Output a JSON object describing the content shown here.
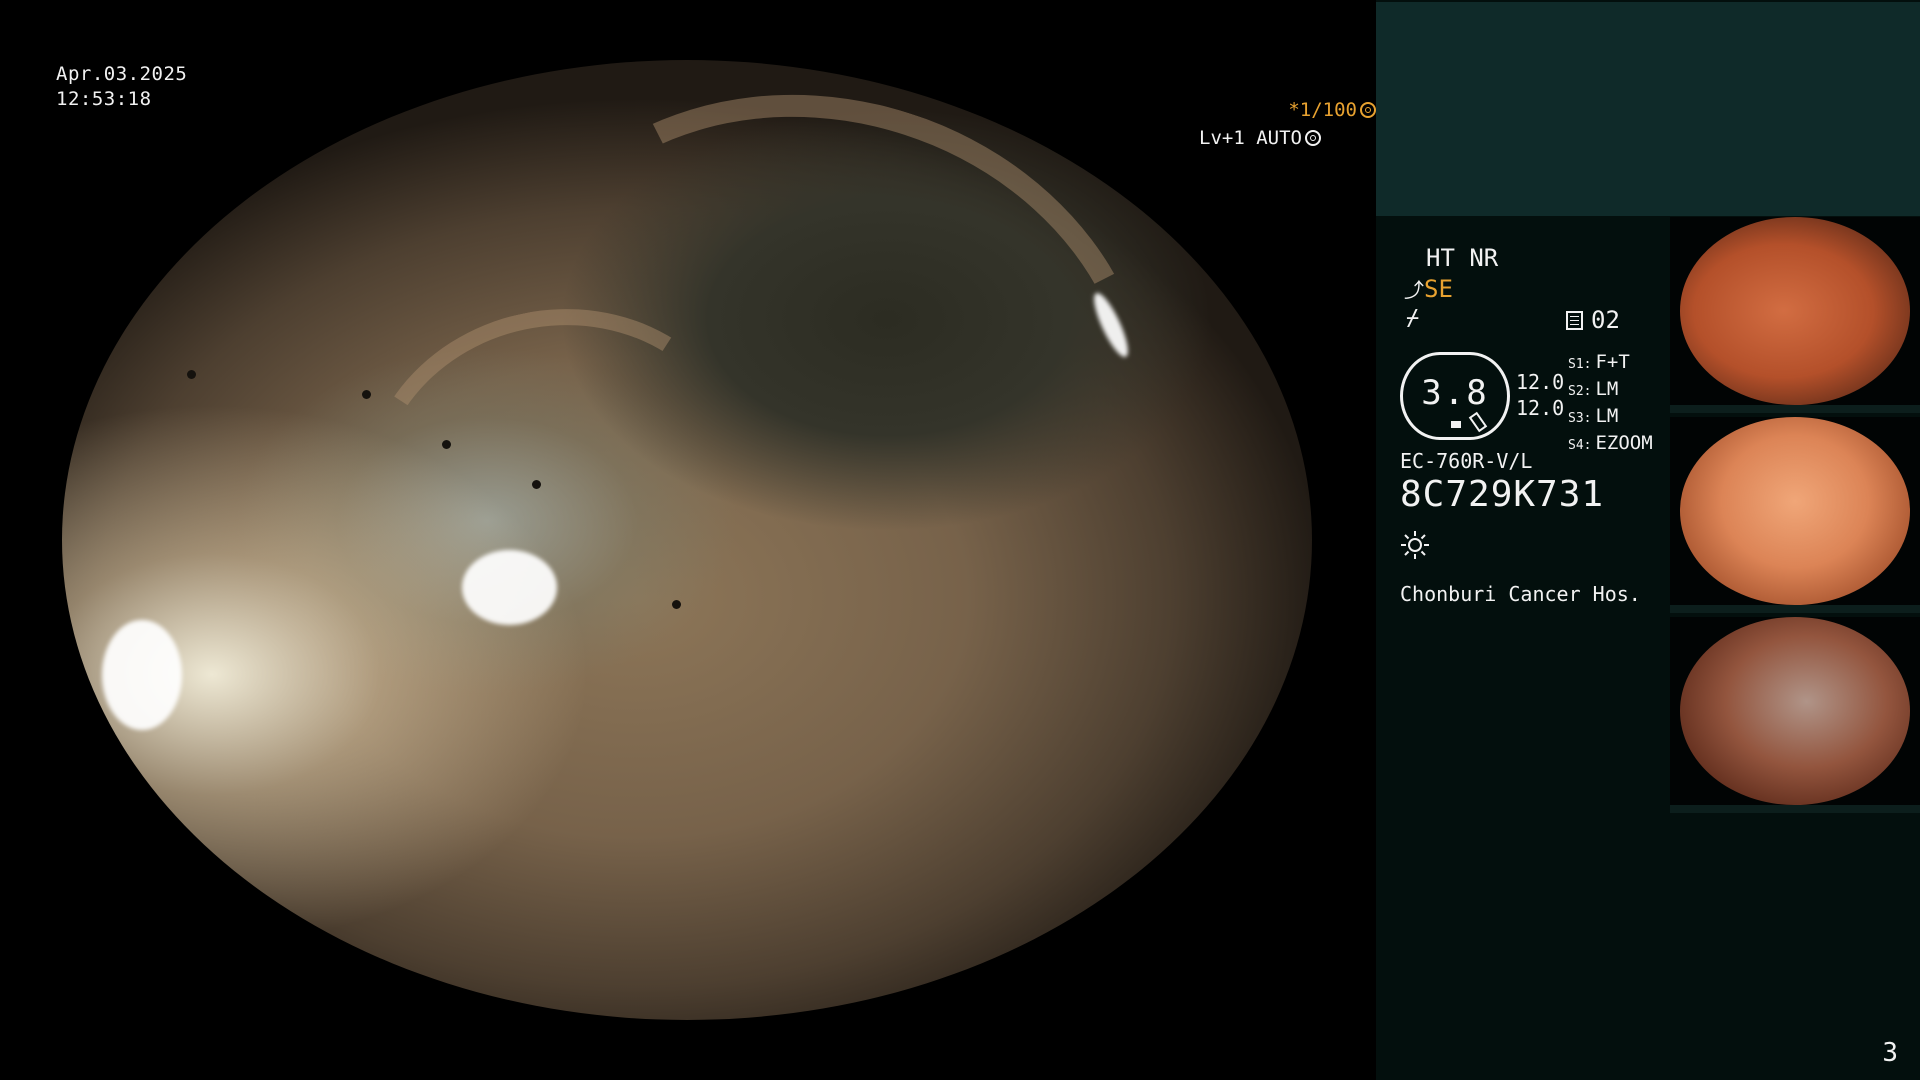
{
  "live_view": {
    "date": "Apr.03.2025",
    "time": "12:53:18",
    "shutter": "*1/100",
    "shutter_icon": "aperture-icon",
    "level": "Lv+1 AUTO",
    "level_icon": "iris-icon",
    "accent_color": "#e8a230"
  },
  "info": {
    "mode": "HT NR",
    "se_label": "SE",
    "mem_label": "02",
    "gauge_value": "3.8",
    "level_1": "12.0",
    "level_2": "12.0",
    "s_keys": [
      "S1:",
      "S2:",
      "S3:",
      "S4:"
    ],
    "s_values": [
      "F+T",
      "LM",
      "LM",
      "EZOOM"
    ],
    "scope_model": "EC-760R-V/L",
    "serial": "8C729K731",
    "hospital": "Chonburi Cancer Hos.",
    "icons": [
      "se-icon",
      "function-icon",
      "memory-icon",
      "light-icon"
    ]
  },
  "thumbnails": [
    {
      "name": "capture-1"
    },
    {
      "name": "capture-2"
    },
    {
      "name": "capture-3"
    }
  ],
  "page_number": "3"
}
